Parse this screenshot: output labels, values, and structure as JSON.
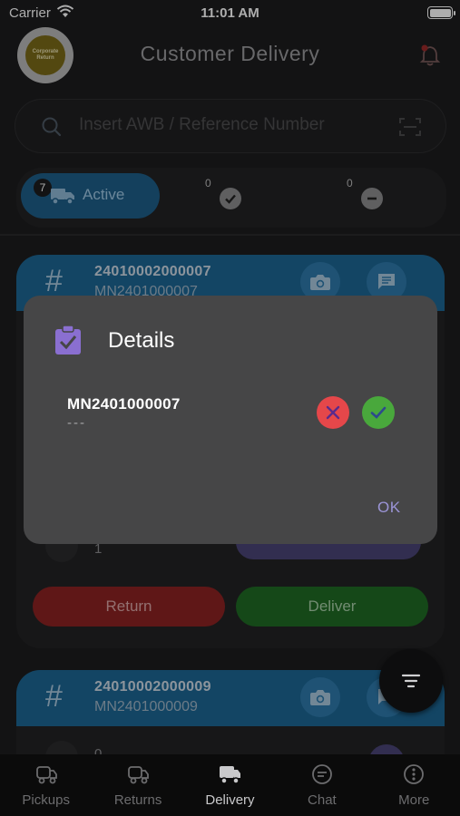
{
  "status_bar": {
    "carrier": "Carrier",
    "time": "11:01 AM"
  },
  "header": {
    "title": "Customer Delivery",
    "logo_line1": "Corporate",
    "logo_line2": "Return"
  },
  "search": {
    "placeholder": "Insert AWB / Reference Number",
    "value": ""
  },
  "filters": {
    "active": {
      "label": "Active",
      "count": "7"
    },
    "delivered": {
      "count": "0"
    },
    "cancelled": {
      "count": "0"
    }
  },
  "cards": [
    {
      "awb": "24010002000007",
      "reference": "MN2401000007",
      "package_count": "1",
      "details_label": "Details",
      "return_label": "Return",
      "deliver_label": "Deliver"
    },
    {
      "awb": "24010002000009",
      "reference": "MN2401000009",
      "package_count": "0"
    }
  ],
  "modal": {
    "title": "Details",
    "item_reference": "MN2401000007",
    "item_subtitle": "---",
    "ok_label": "OK"
  },
  "tabbar": {
    "tabs": [
      {
        "label": "Pickups",
        "icon": "pickup-truck-icon"
      },
      {
        "label": "Returns",
        "icon": "returns-truck-icon"
      },
      {
        "label": "Delivery",
        "icon": "delivery-truck-icon",
        "active": true
      },
      {
        "label": "Chat",
        "icon": "chat-icon"
      },
      {
        "label": "More",
        "icon": "more-icon"
      }
    ]
  },
  "colors": {
    "accent_blue": "#1c6694",
    "modal_bg": "#464647",
    "reject": "#e5474a",
    "accept": "#49a83c",
    "ok": "#9b94d6"
  }
}
